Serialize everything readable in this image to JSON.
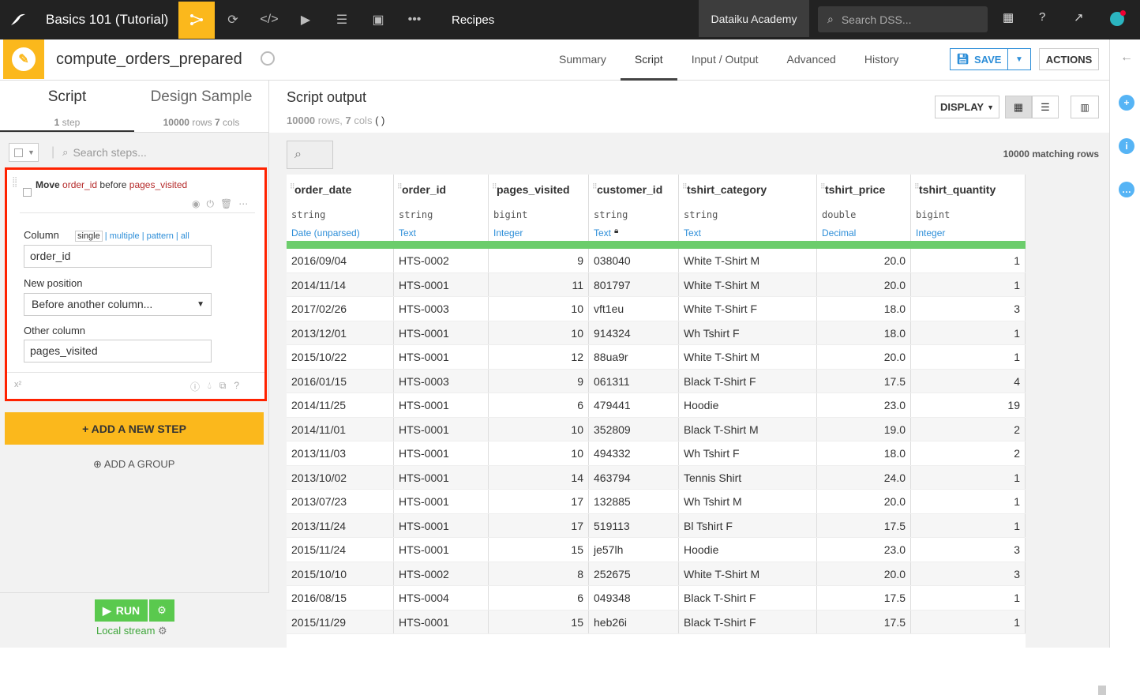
{
  "topnav": {
    "project_name": "Basics 101 (Tutorial)",
    "section": "Recipes",
    "academy": "Dataiku Academy",
    "search_placeholder": "Search DSS..."
  },
  "header": {
    "recipe_name": "compute_orders_prepared",
    "tabs": [
      "Summary",
      "Script",
      "Input / Output",
      "Advanced",
      "History"
    ],
    "active_tab": "Script",
    "save_label": "SAVE",
    "actions_label": "ACTIONS"
  },
  "left": {
    "tab_script": "Script",
    "tab_script_count": "1",
    "tab_script_unit": "step",
    "tab_design": "Design Sample",
    "tab_design_rows": "10000",
    "tab_design_rows_unit": "rows",
    "tab_design_cols": "7",
    "tab_design_cols_unit": "cols",
    "search_placeholder": "Search steps...",
    "step": {
      "verb": "Move",
      "col": "order_id",
      "mid": "before",
      "target": "pages_visited",
      "column_label": "Column",
      "modes": [
        "single",
        "multiple",
        "pattern",
        "all"
      ],
      "column_value": "order_id",
      "position_label": "New position",
      "position_value": "Before another column...",
      "other_label": "Other column",
      "other_value": "pages_visited",
      "x2": "x²"
    },
    "add_step": "+ ADD A NEW STEP",
    "add_group": "ADD A GROUP",
    "run_label": "RUN",
    "engine": "Local stream"
  },
  "main": {
    "title": "Script output",
    "rows_count": "10000",
    "rows_unit": "rows,",
    "cols_count": "7",
    "cols_unit": "cols",
    "paren": "( )",
    "display_label": "DISPLAY",
    "matching": "10000 matching rows",
    "columns": [
      {
        "name": "order_date",
        "type": "string",
        "meaning": "Date (unparsed)"
      },
      {
        "name": "order_id",
        "type": "string",
        "meaning": "Text"
      },
      {
        "name": "pages_visited",
        "type": "bigint",
        "meaning": "Integer"
      },
      {
        "name": "customer_id",
        "type": "string",
        "meaning": "Text"
      },
      {
        "name": "tshirt_category",
        "type": "string",
        "meaning": "Text"
      },
      {
        "name": "tshirt_price",
        "type": "double",
        "meaning": "Decimal"
      },
      {
        "name": "tshirt_quantity",
        "type": "bigint",
        "meaning": "Integer"
      }
    ],
    "rows": [
      [
        "2016/09/04",
        "HTS-0002",
        "9",
        "038040",
        "White T-Shirt M",
        "20.0",
        "1"
      ],
      [
        "2014/11/14",
        "HTS-0001",
        "11",
        "801797",
        "White T-Shirt M",
        "20.0",
        "1"
      ],
      [
        "2017/02/26",
        "HTS-0003",
        "10",
        "vft1eu",
        "White T-Shirt F",
        "18.0",
        "3"
      ],
      [
        "2013/12/01",
        "HTS-0001",
        "10",
        "914324",
        "Wh Tshirt F",
        "18.0",
        "1"
      ],
      [
        "2015/10/22",
        "HTS-0001",
        "12",
        "88ua9r",
        "White T-Shirt M",
        "20.0",
        "1"
      ],
      [
        "2016/01/15",
        "HTS-0003",
        "9",
        "061311",
        "Black T-Shirt F",
        "17.5",
        "4"
      ],
      [
        "2014/11/25",
        "HTS-0001",
        "6",
        "479441",
        "Hoodie",
        "23.0",
        "19"
      ],
      [
        "2014/11/01",
        "HTS-0001",
        "10",
        "352809",
        "Black T-Shirt M",
        "19.0",
        "2"
      ],
      [
        "2013/11/03",
        "HTS-0001",
        "10",
        "494332",
        "Wh Tshirt F",
        "18.0",
        "2"
      ],
      [
        "2013/10/02",
        "HTS-0001",
        "14",
        "463794",
        "Tennis Shirt",
        "24.0",
        "1"
      ],
      [
        "2013/07/23",
        "HTS-0001",
        "17",
        "132885",
        "Wh Tshirt M",
        "20.0",
        "1"
      ],
      [
        "2013/11/24",
        "HTS-0001",
        "17",
        "519113",
        "Bl Tshirt F",
        "17.5",
        "1"
      ],
      [
        "2015/11/24",
        "HTS-0001",
        "15",
        "je57lh",
        "Hoodie",
        "23.0",
        "3"
      ],
      [
        "2015/10/10",
        "HTS-0002",
        "8",
        "252675",
        "White T-Shirt M",
        "20.0",
        "3"
      ],
      [
        "2016/08/15",
        "HTS-0004",
        "6",
        "049348",
        "Black T-Shirt F",
        "17.5",
        "1"
      ],
      [
        "2015/11/29",
        "HTS-0001",
        "15",
        "heb26i",
        "Black T-Shirt F",
        "17.5",
        "1"
      ]
    ]
  },
  "colors": {
    "accent": "#fbb81c",
    "link": "#2d8ed8",
    "valid": "#6ccd6c",
    "highlight": "#ff2200",
    "run": "#5ac94e"
  }
}
